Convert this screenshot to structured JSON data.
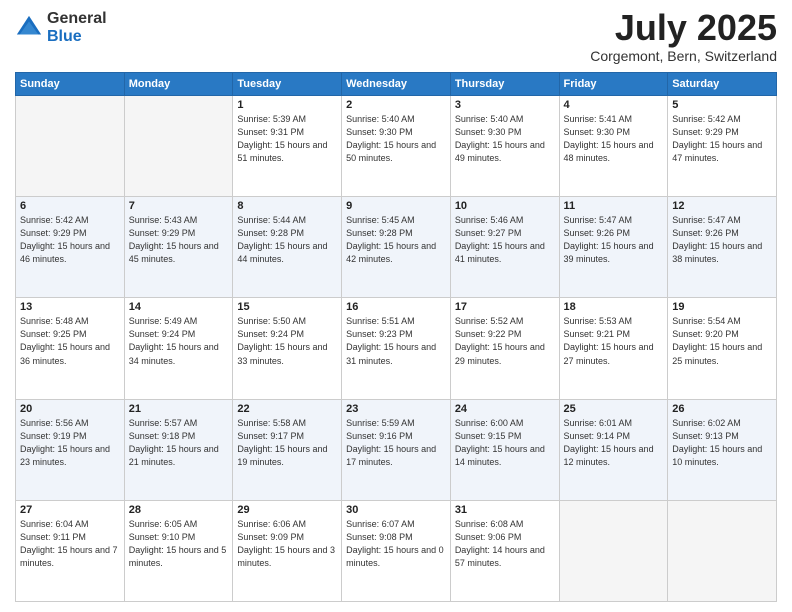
{
  "header": {
    "logo_general": "General",
    "logo_blue": "Blue",
    "title": "July 2025",
    "location": "Corgemont, Bern, Switzerland"
  },
  "days_of_week": [
    "Sunday",
    "Monday",
    "Tuesday",
    "Wednesday",
    "Thursday",
    "Friday",
    "Saturday"
  ],
  "weeks": [
    [
      {
        "day": "",
        "empty": true
      },
      {
        "day": "",
        "empty": true
      },
      {
        "day": "1",
        "sunrise": "5:39 AM",
        "sunset": "9:31 PM",
        "daylight": "15 hours and 51 minutes."
      },
      {
        "day": "2",
        "sunrise": "5:40 AM",
        "sunset": "9:30 PM",
        "daylight": "15 hours and 50 minutes."
      },
      {
        "day": "3",
        "sunrise": "5:40 AM",
        "sunset": "9:30 PM",
        "daylight": "15 hours and 49 minutes."
      },
      {
        "day": "4",
        "sunrise": "5:41 AM",
        "sunset": "9:30 PM",
        "daylight": "15 hours and 48 minutes."
      },
      {
        "day": "5",
        "sunrise": "5:42 AM",
        "sunset": "9:29 PM",
        "daylight": "15 hours and 47 minutes."
      }
    ],
    [
      {
        "day": "6",
        "sunrise": "5:42 AM",
        "sunset": "9:29 PM",
        "daylight": "15 hours and 46 minutes."
      },
      {
        "day": "7",
        "sunrise": "5:43 AM",
        "sunset": "9:29 PM",
        "daylight": "15 hours and 45 minutes."
      },
      {
        "day": "8",
        "sunrise": "5:44 AM",
        "sunset": "9:28 PM",
        "daylight": "15 hours and 44 minutes."
      },
      {
        "day": "9",
        "sunrise": "5:45 AM",
        "sunset": "9:28 PM",
        "daylight": "15 hours and 42 minutes."
      },
      {
        "day": "10",
        "sunrise": "5:46 AM",
        "sunset": "9:27 PM",
        "daylight": "15 hours and 41 minutes."
      },
      {
        "day": "11",
        "sunrise": "5:47 AM",
        "sunset": "9:26 PM",
        "daylight": "15 hours and 39 minutes."
      },
      {
        "day": "12",
        "sunrise": "5:47 AM",
        "sunset": "9:26 PM",
        "daylight": "15 hours and 38 minutes."
      }
    ],
    [
      {
        "day": "13",
        "sunrise": "5:48 AM",
        "sunset": "9:25 PM",
        "daylight": "15 hours and 36 minutes."
      },
      {
        "day": "14",
        "sunrise": "5:49 AM",
        "sunset": "9:24 PM",
        "daylight": "15 hours and 34 minutes."
      },
      {
        "day": "15",
        "sunrise": "5:50 AM",
        "sunset": "9:24 PM",
        "daylight": "15 hours and 33 minutes."
      },
      {
        "day": "16",
        "sunrise": "5:51 AM",
        "sunset": "9:23 PM",
        "daylight": "15 hours and 31 minutes."
      },
      {
        "day": "17",
        "sunrise": "5:52 AM",
        "sunset": "9:22 PM",
        "daylight": "15 hours and 29 minutes."
      },
      {
        "day": "18",
        "sunrise": "5:53 AM",
        "sunset": "9:21 PM",
        "daylight": "15 hours and 27 minutes."
      },
      {
        "day": "19",
        "sunrise": "5:54 AM",
        "sunset": "9:20 PM",
        "daylight": "15 hours and 25 minutes."
      }
    ],
    [
      {
        "day": "20",
        "sunrise": "5:56 AM",
        "sunset": "9:19 PM",
        "daylight": "15 hours and 23 minutes."
      },
      {
        "day": "21",
        "sunrise": "5:57 AM",
        "sunset": "9:18 PM",
        "daylight": "15 hours and 21 minutes."
      },
      {
        "day": "22",
        "sunrise": "5:58 AM",
        "sunset": "9:17 PM",
        "daylight": "15 hours and 19 minutes."
      },
      {
        "day": "23",
        "sunrise": "5:59 AM",
        "sunset": "9:16 PM",
        "daylight": "15 hours and 17 minutes."
      },
      {
        "day": "24",
        "sunrise": "6:00 AM",
        "sunset": "9:15 PM",
        "daylight": "15 hours and 14 minutes."
      },
      {
        "day": "25",
        "sunrise": "6:01 AM",
        "sunset": "9:14 PM",
        "daylight": "15 hours and 12 minutes."
      },
      {
        "day": "26",
        "sunrise": "6:02 AM",
        "sunset": "9:13 PM",
        "daylight": "15 hours and 10 minutes."
      }
    ],
    [
      {
        "day": "27",
        "sunrise": "6:04 AM",
        "sunset": "9:11 PM",
        "daylight": "15 hours and 7 minutes."
      },
      {
        "day": "28",
        "sunrise": "6:05 AM",
        "sunset": "9:10 PM",
        "daylight": "15 hours and 5 minutes."
      },
      {
        "day": "29",
        "sunrise": "6:06 AM",
        "sunset": "9:09 PM",
        "daylight": "15 hours and 3 minutes."
      },
      {
        "day": "30",
        "sunrise": "6:07 AM",
        "sunset": "9:08 PM",
        "daylight": "15 hours and 0 minutes."
      },
      {
        "day": "31",
        "sunrise": "6:08 AM",
        "sunset": "9:06 PM",
        "daylight": "14 hours and 57 minutes."
      },
      {
        "day": "",
        "empty": true
      },
      {
        "day": "",
        "empty": true
      }
    ]
  ],
  "labels": {
    "sunrise_label": "Sunrise:",
    "sunset_label": "Sunset:",
    "daylight_label": "Daylight:"
  }
}
